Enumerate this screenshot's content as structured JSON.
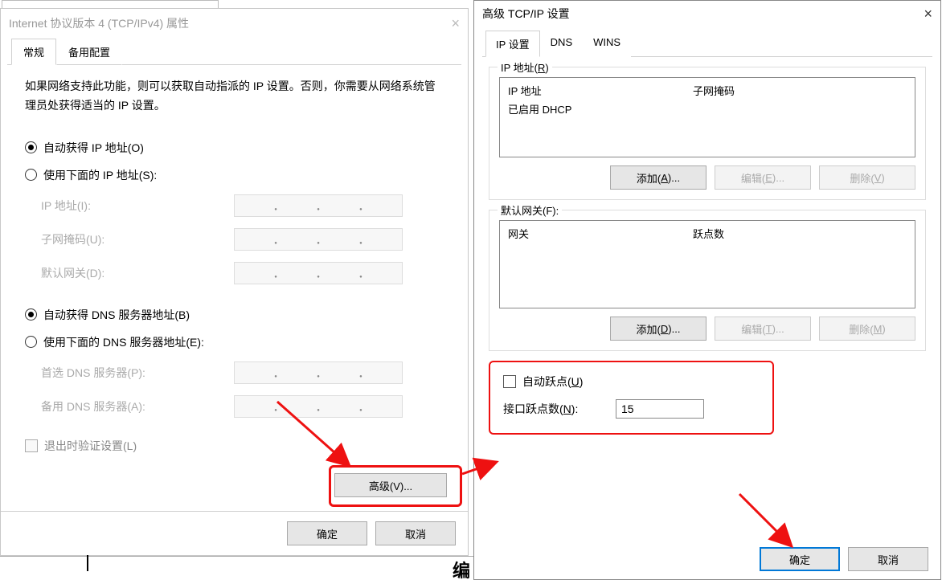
{
  "left": {
    "title": "Internet 协议版本 4 (TCP/IPv4) 属性",
    "tabs": {
      "general": "常规",
      "alt": "备用配置"
    },
    "desc": "如果网络支持此功能，则可以获取自动指派的 IP 设置。否则，你需要从网络系统管理员处获得适当的 IP 设置。",
    "auto_ip": "自动获得 IP 地址(O)",
    "manual_ip": "使用下面的 IP 地址(S):",
    "ip_label": "IP 地址(I):",
    "mask_label": "子网掩码(U):",
    "gw_label": "默认网关(D):",
    "auto_dns": "自动获得 DNS 服务器地址(B)",
    "manual_dns": "使用下面的 DNS 服务器地址(E):",
    "pref_dns": "首选 DNS 服务器(P):",
    "alt_dns": "备用 DNS 服务器(A):",
    "validate": "退出时验证设置(L)",
    "advanced": "高级(V)...",
    "ok": "确定",
    "cancel": "取消"
  },
  "right": {
    "title": "高级 TCP/IP 设置",
    "tabs": {
      "ip": "IP 设置",
      "dns": "DNS",
      "wins": "WINS"
    },
    "grp_ip_label": "IP 地址(R)",
    "list_ip_hdr1": "IP 地址",
    "list_ip_hdr2": "子网掩码",
    "dhcp_row": "已启用 DHCP",
    "btn_add": "添加(A)...",
    "btn_edit_e": "编辑(E)...",
    "btn_del_v": "删除(V)",
    "grp_gw_label": "默认网关(F):",
    "list_gw_hdr1": "网关",
    "list_gw_hdr2": "跃点数",
    "btn_add_d": "添加(D)...",
    "btn_edit_t": "编辑(T)...",
    "btn_del_m": "删除(M)",
    "auto_metric": "自动跃点(U)",
    "if_metric": "接口跃点数(N):",
    "if_metric_value": "15",
    "ok": "确定",
    "cancel": "取消"
  },
  "misc": {
    "page_label": "编"
  }
}
